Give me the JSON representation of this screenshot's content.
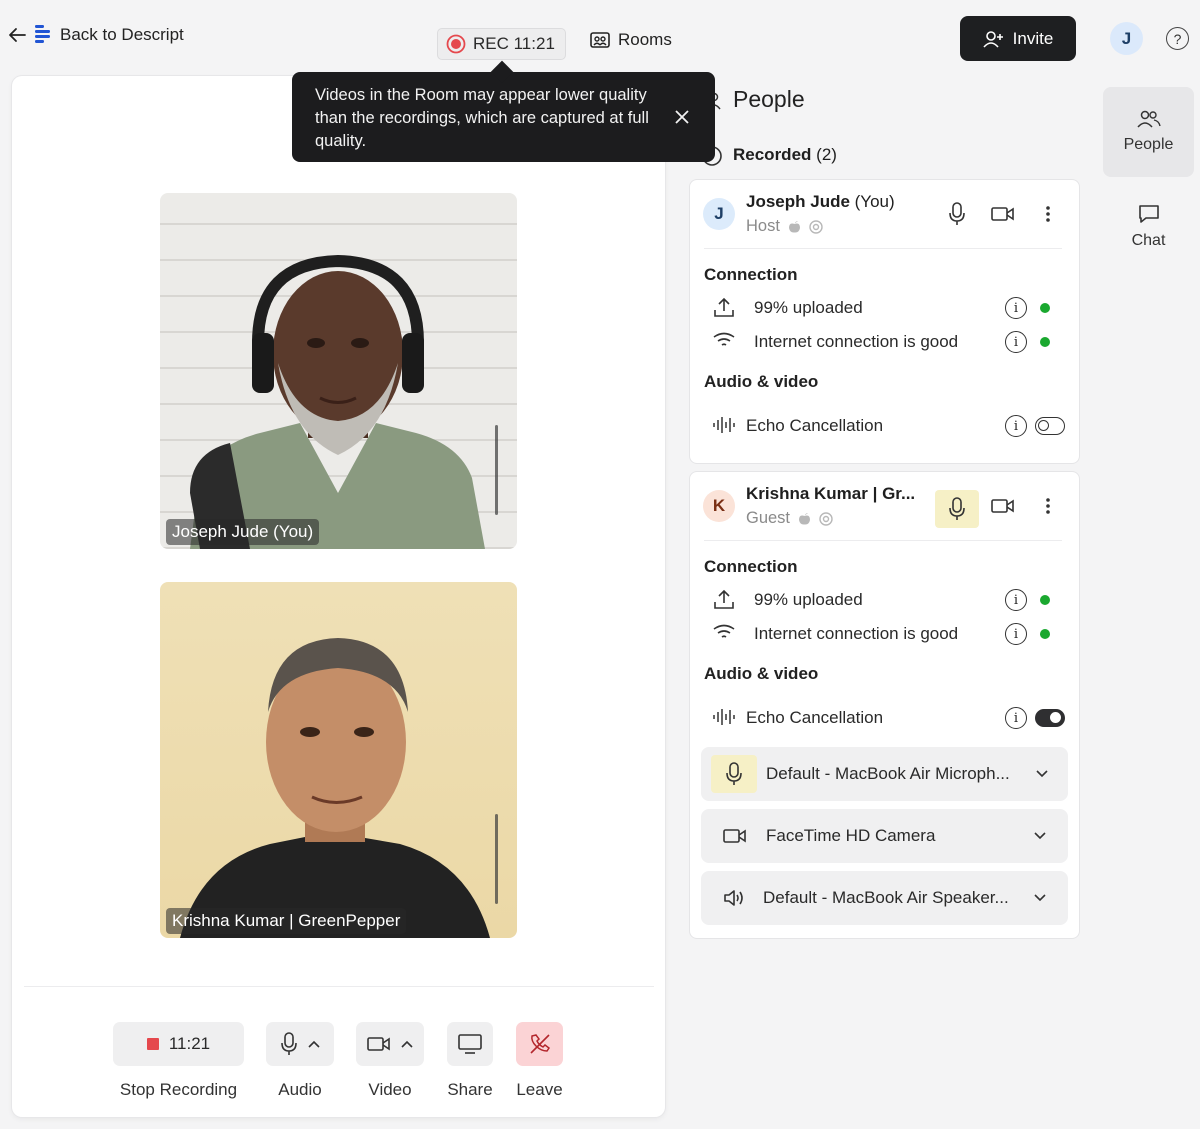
{
  "header": {
    "back_label": "Back to Descript",
    "rec_label": "REC 11:21",
    "rooms_label": "Rooms",
    "invite_label": "Invite",
    "user_initial": "J",
    "help_label": "?"
  },
  "tooltip": {
    "text": "Videos in the Room may appear lower quality than the recordings, which are captured at full quality."
  },
  "stage": {
    "tiles": [
      {
        "name": "Joseph Jude (You)"
      },
      {
        "name": "Krishna Kumar | GreenPepper"
      }
    ],
    "controls": {
      "timer": "11:21",
      "stop_recording": "Stop Recording",
      "audio": "Audio",
      "video": "Video",
      "share": "Share",
      "leave": "Leave"
    }
  },
  "panel": {
    "title": "People",
    "recorded_label": "Recorded",
    "recorded_count": "(2)",
    "participants": [
      {
        "initial": "J",
        "name": "Joseph Jude",
        "suffix": " (You)",
        "role": "Host",
        "connection_heading": "Connection",
        "upload_text": "99% uploaded",
        "internet_text": "Internet connection is good",
        "av_heading": "Audio & video",
        "echo_label": "Echo Cancellation",
        "echo_on": false
      },
      {
        "initial": "K",
        "name": "Krishna Kumar | Gr...",
        "suffix": "",
        "role": "Guest",
        "connection_heading": "Connection",
        "upload_text": "99% uploaded",
        "internet_text": "Internet connection is good",
        "av_heading": "Audio & video",
        "echo_label": "Echo Cancellation",
        "echo_on": true
      }
    ],
    "devices": {
      "microphone": "Default - MacBook Air Microph...",
      "camera": "FaceTime HD Camera",
      "speaker": "Default - MacBook Air Speaker..."
    }
  },
  "rail": {
    "people_label": "People",
    "chat_label": "Chat"
  },
  "colors": {
    "status_good": "#1aa82f",
    "rec_red": "#e5484d",
    "leave_bg": "#fbd3d5",
    "mic_highlight": "#f6f0c6",
    "invite_bg": "#1e1f21"
  }
}
